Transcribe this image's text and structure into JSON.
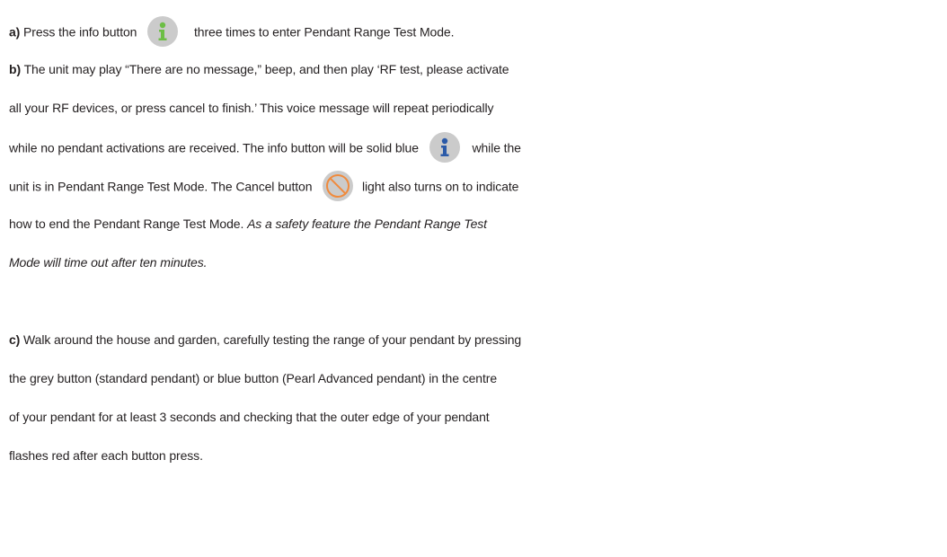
{
  "step_a": {
    "label": "a)",
    "text_before": "Press the info button",
    "text_after": "three times to enter Pendant Range Test Mode.",
    "icon_color": "#6cbe45"
  },
  "step_b": {
    "label": "b)",
    "line1": "The unit may play “There are no message,” beep, and then play ‘RF test, please activate",
    "line2": "all your RF devices, or press cancel to finish.’  This voice message will repeat periodically",
    "line3_before": "while no pendant activations are received.   The info button will be solid blue",
    "line3_after": "while the",
    "line4_before": "unit is in Pendant Range Test Mode.  The Cancel button",
    "line4_after": "light also turns on to indicate",
    "line5_normal": "how to end the Pendant Range Test Mode.",
    "line5_italic": "As a safety feature the Pendant Range Test",
    "line6_italic": "Mode will time out after ten minutes.",
    "info_icon_color": "#2b5aa8",
    "cancel_icon_color": "#f08a3c"
  },
  "step_c": {
    "label": "c)",
    "line1": "Walk around the house and garden, carefully testing the range of your pendant by pressing",
    "line2": "the grey button (standard pendant) or blue button (Pearl Advanced pendant) in the centre",
    "line3": "of your pendant for at least 3 seconds and checking that the outer edge of your pendant",
    "line4": "flashes red after each button press."
  }
}
